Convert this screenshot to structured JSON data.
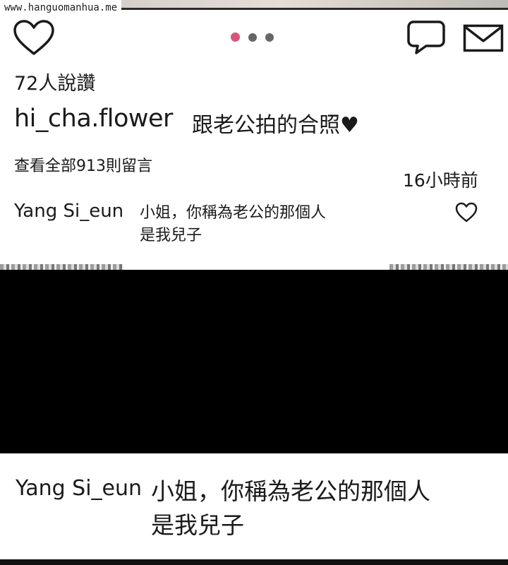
{
  "watermark": "www.hanguomanhua.me",
  "header": {
    "like_icon": "heart-outline-icon",
    "comment_icon": "speech-bubble-icon",
    "message_icon": "envelope-icon",
    "carousel_dots": 3,
    "carousel_active_index": 0,
    "active_dot_color": "#d7557a"
  },
  "post": {
    "likes": "72人說讚",
    "username": "hi_cha.flower",
    "caption": "跟老公拍的合照♥",
    "view_all_comments": "查看全部913則留言",
    "time_ago": "16小時前"
  },
  "comment": {
    "username": "Yang Si_eun",
    "line1": "小姐，你稱為老公的那個人",
    "line2": "是我兒子",
    "like_icon": "heart-outline-icon"
  },
  "zoomed_comment": {
    "username": "Yang Si_eun",
    "line1": "小姐，你稱為老公的那個人",
    "line2": "是我兒子"
  }
}
